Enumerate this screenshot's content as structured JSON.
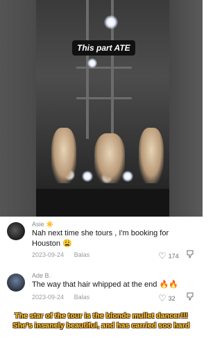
{
  "video": {
    "caption": "This part ATE"
  },
  "comments": [
    {
      "username": "Asie",
      "username_emoji": "☀️",
      "text": "Nah next time she tours , I'm booking for Houston 😩",
      "date": "2023-09-24",
      "reply_label": "Balas",
      "likes": "174"
    },
    {
      "username": "Ade B.",
      "text": "The way that hair whipped at the end 🔥🔥",
      "date": "2023-09-24",
      "reply_label": "Balas",
      "likes": "32"
    }
  ],
  "banner": {
    "line1": "The star of the tour is the blonde mullet dancer!!!",
    "line2": "She's insanely beautiful, and has carried soo hard"
  },
  "colors": {
    "banner_text": "#f5d84a",
    "banner_outline": "#5a2a00"
  }
}
